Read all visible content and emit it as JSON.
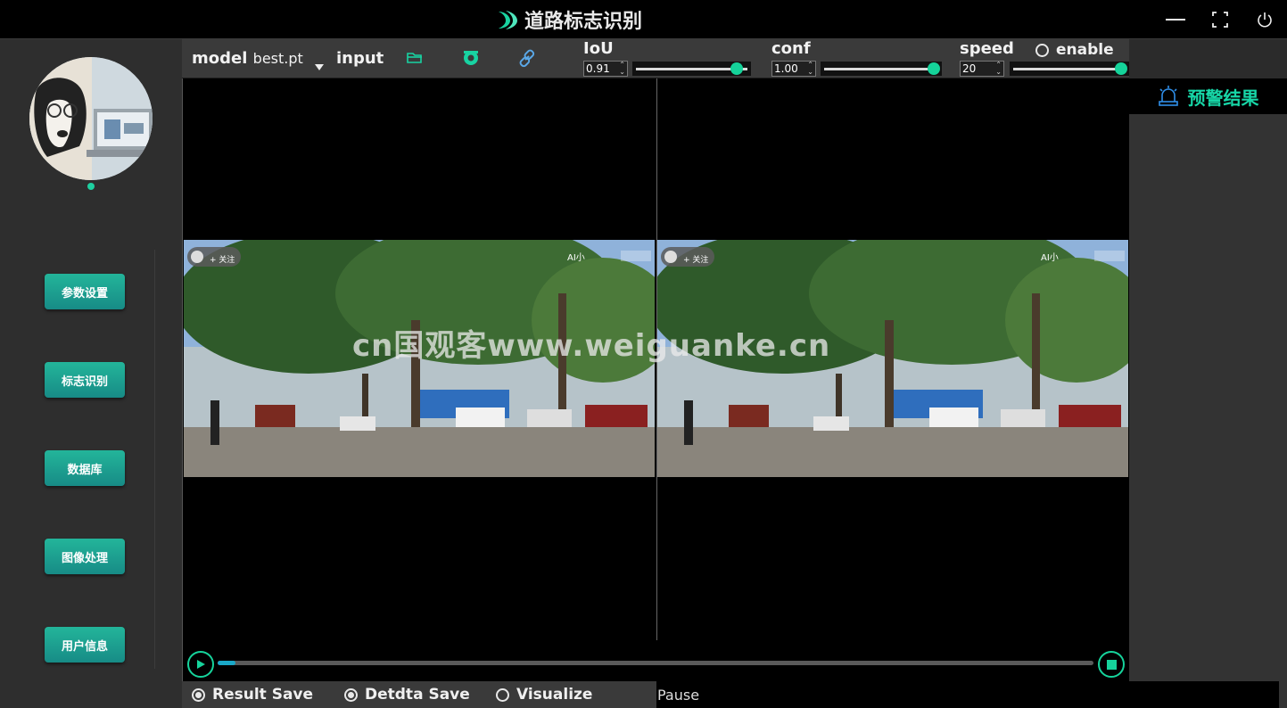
{
  "app": {
    "title": "道路标志识别"
  },
  "window": {
    "minimize_icon": "minimize-icon",
    "maximize_icon": "maximize-icon",
    "power_icon": "power-icon"
  },
  "nav": {
    "items": [
      {
        "label": "参数设置"
      },
      {
        "label": "标志识别"
      },
      {
        "label": "数据库"
      },
      {
        "label": "图像处理"
      },
      {
        "label": "用户信息"
      }
    ]
  },
  "toolbar": {
    "model_label": "model",
    "model_value": "best.pt",
    "input_label": "input",
    "icons": [
      "folder-icon",
      "camera-icon",
      "link-icon"
    ],
    "iou": {
      "label": "IoU",
      "value": "0.91"
    },
    "conf": {
      "label": "conf",
      "value": "1.00"
    },
    "speed": {
      "label": "speed",
      "value": "20"
    },
    "enable_label": "enable"
  },
  "video": {
    "overlay_follow": "+ 关注",
    "overlay_right": "AI小",
    "watermark": "cn国观客www.weiguanke.cn",
    "progress": 0.02
  },
  "right_panel": {
    "title": "预警结果"
  },
  "bottom": {
    "options": [
      {
        "label": "Result Save",
        "checked": true
      },
      {
        "label": "Detdta Save",
        "checked": true
      },
      {
        "label": "Visualize",
        "checked": false
      }
    ],
    "status": "Pause"
  },
  "colors": {
    "accent": "#15d39a",
    "panel": "#3a3a3a",
    "sidebar": "#2e2e2e"
  }
}
